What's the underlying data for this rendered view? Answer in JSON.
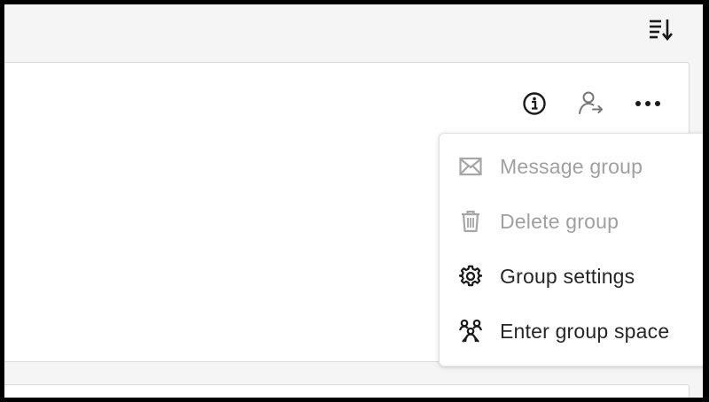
{
  "toolbar": {
    "sort_icon": "sort-descending-icon"
  },
  "card_actions": [
    {
      "icon": "info-icon"
    },
    {
      "icon": "user-transfer-icon"
    },
    {
      "icon": "more-horizontal-icon"
    }
  ],
  "menu": {
    "items": [
      {
        "label": "Message group",
        "icon": "envelope-icon",
        "disabled": true
      },
      {
        "label": "Delete group",
        "icon": "trash-icon",
        "disabled": true
      },
      {
        "label": "Group settings",
        "icon": "gear-icon",
        "disabled": false
      },
      {
        "label": "Enter group space",
        "icon": "group-space-icon",
        "disabled": false
      }
    ]
  },
  "colors": {
    "disabled": "#a0a0a0",
    "enabled": "#262626",
    "icon_gray": "#777777"
  }
}
